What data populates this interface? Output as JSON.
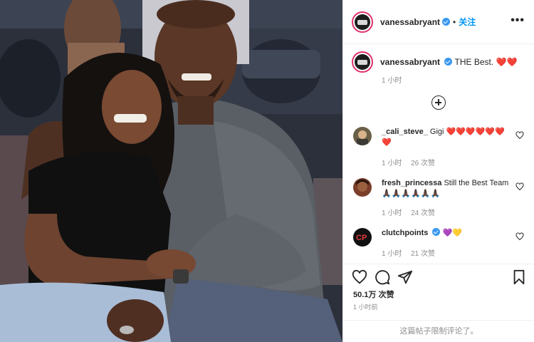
{
  "post": {
    "username": "vanessabryant",
    "follow_label": "关注",
    "more_label": "•••",
    "caption_text": "THE Best. ❤️❤️",
    "caption_time": "1 小时"
  },
  "comments": [
    {
      "username": "_cali_steve_",
      "text": "Gigi ❤️❤️❤️❤️❤️❤️❤️",
      "time": "1 小时",
      "likes": "26 次赞"
    },
    {
      "username": "fresh_princessa",
      "text": "Still the Best Team🙏🏿🙏🏿🙏🏿🙏🏿🙏🏿🙏🏿",
      "time": "1 小时",
      "likes": "24 次赞"
    },
    {
      "username": "clutchpoints",
      "text": "💜💛",
      "time": "1 小时",
      "likes": "21 次赞"
    }
  ],
  "stats": {
    "likes": "50.1万 次赞",
    "posted": "1 小时前",
    "comments_limited": "这篇帖子限制评论了。"
  },
  "colors": {
    "verified": "#3897f0",
    "follow": "#0095f6",
    "heart": "#ed4956"
  }
}
